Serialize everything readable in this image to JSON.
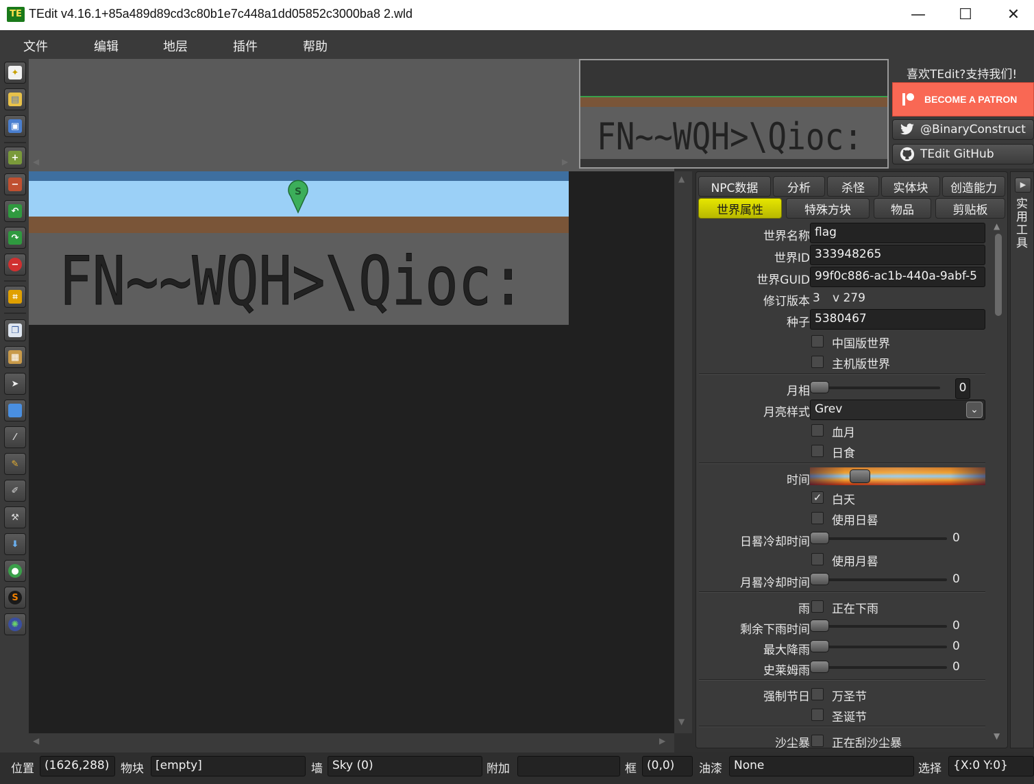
{
  "window": {
    "app_icon": "TE",
    "title": "TEdit v4.16.1+85a489d89cd3c80b1e7c448a1dd05852c3000ba8 2.wld",
    "minimize": "—",
    "maximize": "☐",
    "close": "✕"
  },
  "menu": [
    "文件",
    "编辑",
    "地层",
    "插件",
    "帮助"
  ],
  "toolbar": {
    "icons": [
      "new-world-icon",
      "open-world-icon",
      "save-world-icon",
      "zoom-in-icon",
      "zoom-out-icon",
      "undo-icon",
      "redo-icon",
      "cancel-icon",
      "crop-icon",
      "copy-icon",
      "paste-icon",
      "arrow-select-icon",
      "selection-rect-icon",
      "picker-icon",
      "pencil-icon",
      "brush-icon",
      "hammer-icon",
      "fill-icon",
      "world-sprite-icon",
      "spawn-icon",
      "morph-icon"
    ],
    "spawn_marker": "S"
  },
  "canvas": {
    "world_text": "FN~~WQH>\\Qioc:",
    "spawn_label": "S"
  },
  "support": {
    "like_text": "喜欢TEdit?支持我们!",
    "patron_label": "BECOME A PATRON",
    "twitter_label": "@BinaryConstruct",
    "github_label": "TEdit GitHub"
  },
  "tabs": {
    "row1": [
      "NPC数据",
      "分析",
      "杀怪",
      "实体块",
      "创造能力"
    ],
    "row2": [
      "世界属性",
      "特殊方块",
      "物品",
      "剪贴板"
    ],
    "active": "世界属性"
  },
  "side_tab": {
    "label": "实用工具",
    "arrow": "▶"
  },
  "props": {
    "world_name_label": "世界名称",
    "world_name": "flag",
    "world_id_label": "世界ID",
    "world_id": "333948265",
    "world_guid_label": "世界GUID",
    "world_guid": "99f0c886-ac1b-440a-9abf-5",
    "revision_label": "修订版本",
    "revision": "3",
    "version": "v 279",
    "seed_label": "种子",
    "seed": "5380467",
    "china_world": "中国版世界",
    "console_world": "主机版世界",
    "moon_phase_label": "月相",
    "moon_phase": "0",
    "moon_style_label": "月亮样式",
    "moon_style": "Grev",
    "blood_moon": "血月",
    "eclipse": "日食",
    "time_label": "时间",
    "daytime": "白天",
    "daytime_checked": "✓",
    "use_sundial": "使用日晷",
    "sundial_cooldown_label": "日晷冷却时间",
    "sundial_cooldown": "0",
    "use_moondial": "使用月晷",
    "moondial_cooldown_label": "月晷冷却时间",
    "moondial_cooldown": "0",
    "rain_label": "雨",
    "is_raining": "正在下雨",
    "rain_time_left_label": "剩余下雨时间",
    "rain_time_left": "0",
    "max_rain_label": "最大降雨",
    "max_rain": "0",
    "slime_rain_label": "史莱姆雨",
    "slime_rain": "0",
    "force_holiday_label": "强制节日",
    "halloween": "万圣节",
    "christmas": "圣诞节",
    "sandstorm_label": "沙尘暴",
    "is_sandstorm": "正在刮沙尘暴"
  },
  "status": {
    "position_label": "位置",
    "position": "(1626,288)",
    "tile_label": "物块",
    "tile": "[empty]",
    "wall_label": "墙",
    "wall": "Sky (0)",
    "extra_label": "附加",
    "extra": "",
    "frame_label": "框",
    "frame": "(0,0)",
    "paint_label": "油漆",
    "paint": "None",
    "selection_label": "选择",
    "selection": "{X:0 Y:0}"
  },
  "colors": {
    "accent_tab": "#e6e600",
    "patron": "#f96854",
    "sky_band": "#9bd0f7",
    "dirt_band": "#7a5538",
    "stone": "#5e5e5e"
  }
}
